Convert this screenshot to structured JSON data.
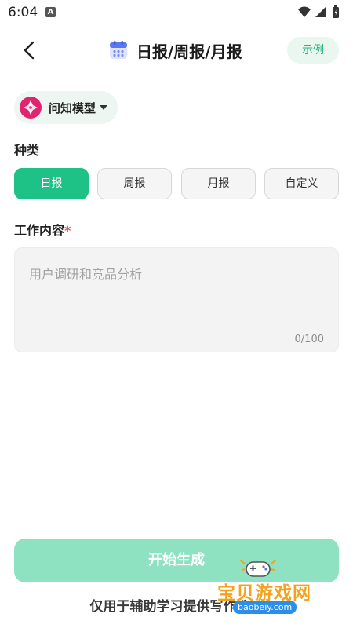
{
  "status_bar": {
    "time": "6:04",
    "notification_glyph": "A",
    "icons": [
      "wifi-icon",
      "signal-icon",
      "battery-icon"
    ]
  },
  "header": {
    "back_icon": "chevron-left-icon",
    "calendar_icon": "calendar-icon",
    "title": "日报/周报/月报",
    "example_label": "示例"
  },
  "model_selector": {
    "logo_icon": "model-logo-icon",
    "label": "问知模型",
    "caret_icon": "caret-down-icon"
  },
  "type_section": {
    "label": "种类",
    "options": [
      {
        "label": "日报",
        "selected": true
      },
      {
        "label": "周报",
        "selected": false
      },
      {
        "label": "月报",
        "selected": false
      },
      {
        "label": "自定义",
        "selected": false
      }
    ]
  },
  "content_section": {
    "label": "工作内容",
    "required_mark": "*",
    "value": "",
    "placeholder": "用户调研和竞品分析",
    "char_count": "0/100"
  },
  "generate_button": {
    "label": "开始生成"
  },
  "disclaimer": "仅用于辅助学习提供写作参考",
  "watermark": {
    "title": "宝贝游戏网",
    "url": "baobeiy.com",
    "icon": "gamepad-icon"
  },
  "colors": {
    "accent": "#1ec186",
    "accent_light": "#8ee2c2",
    "example_text": "#1fb77d",
    "required": "#e34d4d"
  }
}
